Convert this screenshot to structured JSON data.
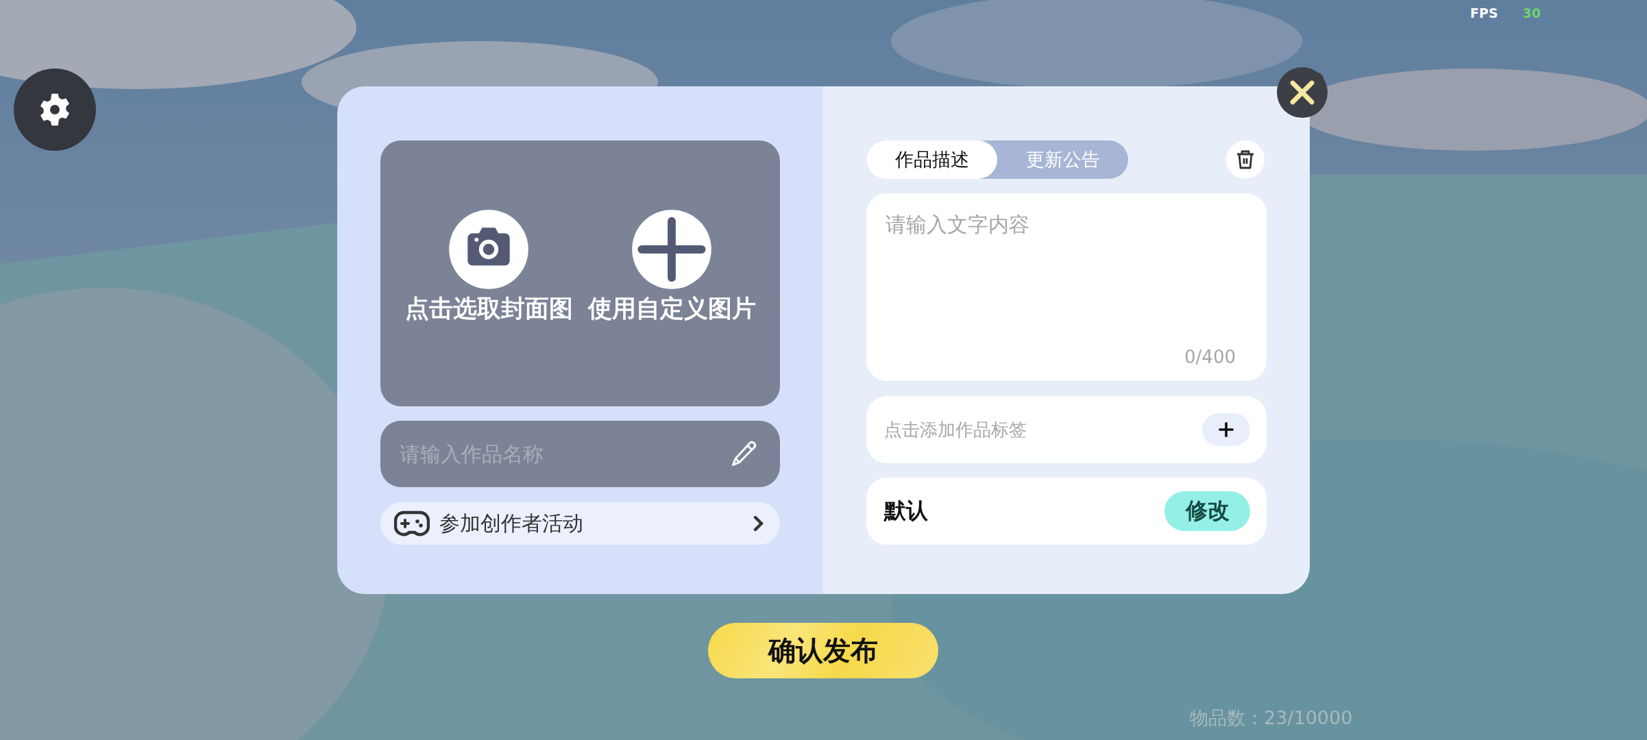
{
  "hud": {
    "fps_label": "FPS",
    "fps_value": "30"
  },
  "cover": {
    "actions": [
      {
        "kind": "camera",
        "label": "点击选取封面图"
      },
      {
        "kind": "add",
        "label": "使用自定义图片"
      }
    ]
  },
  "name_field": {
    "placeholder": "请输入作品名称"
  },
  "activity": {
    "label": "参加创作者活动"
  },
  "tabs": [
    {
      "label": "作品描述",
      "selected": true
    },
    {
      "label": "更新公告",
      "selected": false
    }
  ],
  "description": {
    "placeholder": "请输入文字内容",
    "counter": "0/400"
  },
  "tags": {
    "prompt": "点击添加作品标签"
  },
  "category": {
    "value": "默认",
    "button": "修改"
  },
  "confirm_button": "确认发布",
  "item_count": "物品数：23/10000"
}
